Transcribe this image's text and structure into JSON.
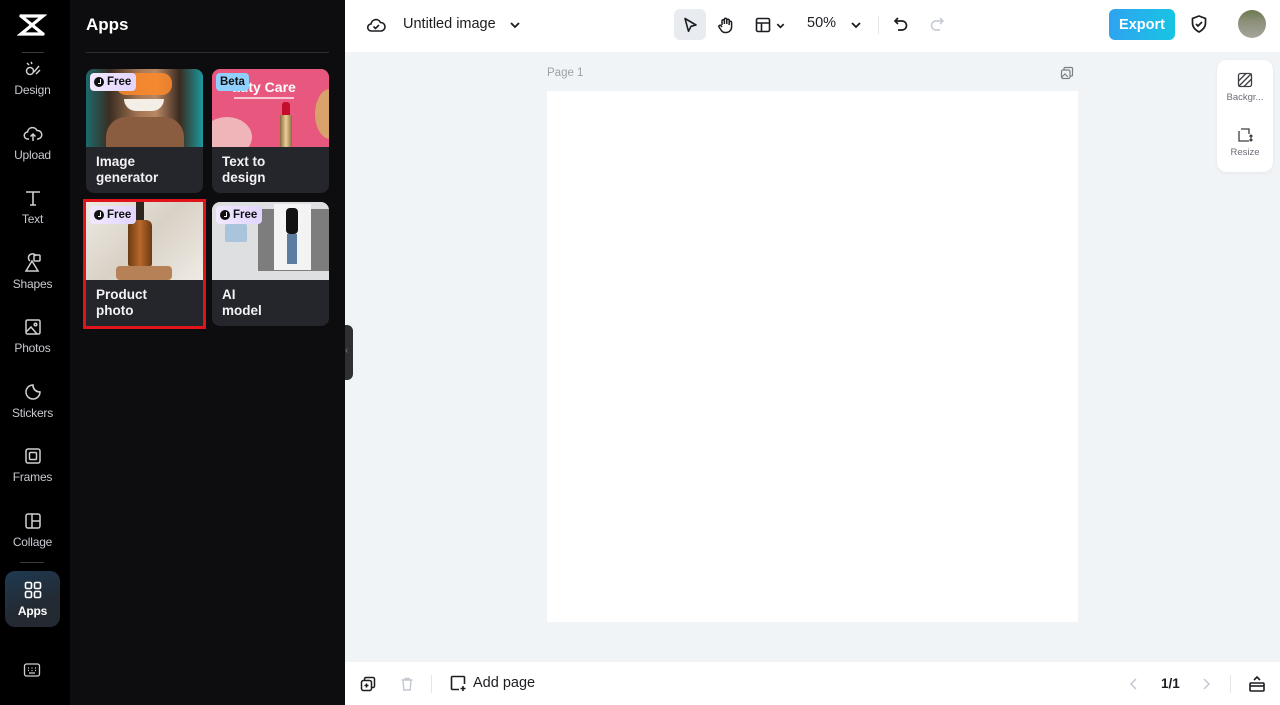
{
  "rail": {
    "items": [
      {
        "id": "design",
        "label": "Design",
        "icon": "design-icon"
      },
      {
        "id": "upload",
        "label": "Upload",
        "icon": "cloud-upload-icon"
      },
      {
        "id": "text",
        "label": "Text",
        "icon": "text-icon"
      },
      {
        "id": "shapes",
        "label": "Shapes",
        "icon": "shapes-icon"
      },
      {
        "id": "photos",
        "label": "Photos",
        "icon": "image-icon"
      },
      {
        "id": "stickers",
        "label": "Stickers",
        "icon": "sticker-icon"
      },
      {
        "id": "frames",
        "label": "Frames",
        "icon": "frame-icon"
      },
      {
        "id": "collage",
        "label": "Collage",
        "icon": "collage-icon"
      },
      {
        "id": "apps",
        "label": "Apps",
        "icon": "apps-grid-icon",
        "active": true
      }
    ],
    "bottom_icon": "keyboard-icon"
  },
  "panel": {
    "title": "Apps",
    "cards": [
      {
        "name_line1": "Image",
        "name_line2": "generator",
        "badge": "Free",
        "badge_type": "free"
      },
      {
        "name_line1": "Text to",
        "name_line2": "design",
        "badge": "Beta",
        "badge_type": "beta",
        "thumb_text": "auty Care"
      },
      {
        "name_line1": "Product",
        "name_line2": "photo",
        "badge": "Free",
        "badge_type": "free",
        "selected": true
      },
      {
        "name_line1": "AI",
        "name_line2": "model",
        "badge": "Free",
        "badge_type": "free"
      }
    ]
  },
  "topbar": {
    "doc_title": "Untitled image",
    "zoom": "50%",
    "export_label": "Export",
    "accent": "#22b3ea"
  },
  "canvas": {
    "page_label": "Page 1"
  },
  "side_tools": [
    {
      "label": "Backgr..."
    },
    {
      "label": "Resize"
    }
  ],
  "bottombar": {
    "add_page_label": "Add page",
    "pager": "1/1"
  }
}
